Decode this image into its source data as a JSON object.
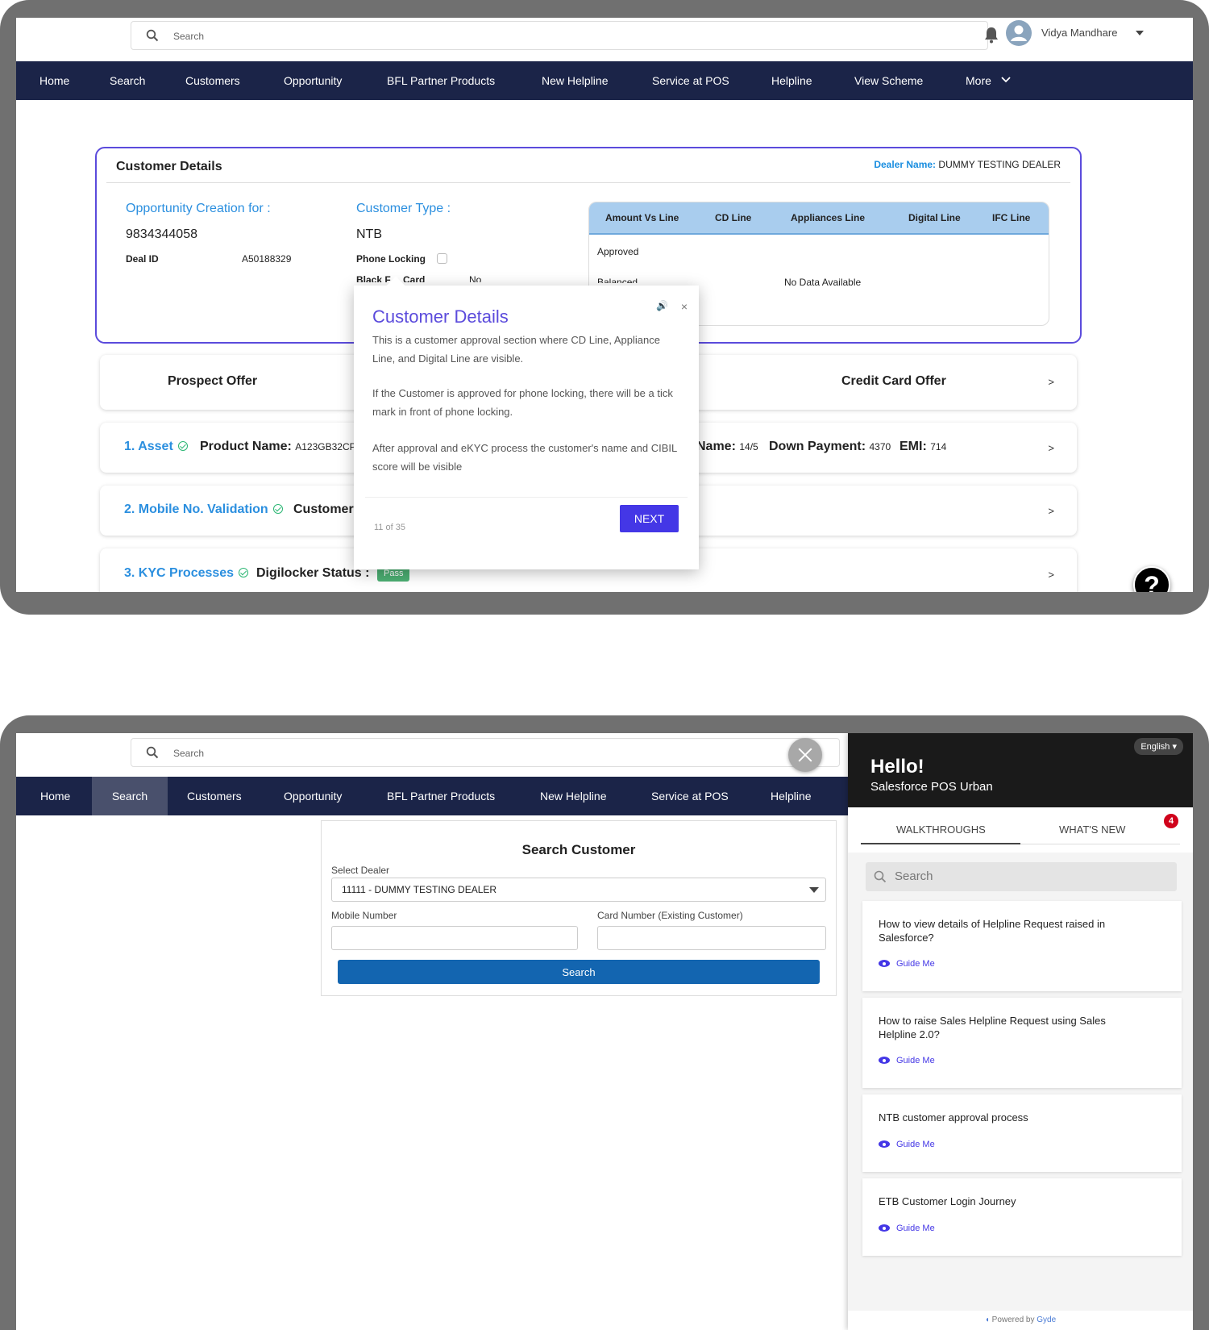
{
  "screen1": {
    "search_placeholder": "Search",
    "user_name": "Vidya Mandhare",
    "nav": [
      "Home",
      "Search",
      "Customers",
      "Opportunity",
      "BFL Partner Products",
      "New Helpline",
      "Service at POS",
      "Helpline",
      "View Scheme",
      "More"
    ],
    "customer_details": {
      "title": "Customer Details",
      "dealer_label": "Dealer Name:",
      "dealer_value": "DUMMY TESTING DEALER",
      "opp_label": "Opportunity Creation for :",
      "opp_value": "9834344058",
      "deal_id_label": "Deal ID",
      "deal_id_value": "A50188329",
      "cust_type_label": "Customer Type :",
      "cust_type_value": "NTB",
      "phone_locking_label": "Phone Locking",
      "black_card_label": "Black F",
      "black_card_label2": "Card",
      "black_card_value": "No",
      "table_headers": [
        "Amount Vs Line",
        "CD Line",
        "Appliances Line",
        "Digital Line",
        "IFC Line"
      ],
      "row_approved": "Approved",
      "row_balanced": "Balanced",
      "no_data": "No Data Available"
    },
    "prospect_offer": "Prospect Offer",
    "credit_card_offer": "Credit Card Offer",
    "asset": {
      "label": "1. Asset",
      "product_label": "Product Name:",
      "product_value": "A123GB32CP",
      "scheme_label": "Name:",
      "scheme_value": "14/5",
      "down_label": "Down Payment:",
      "down_value": "4370",
      "emi_label": "EMI:",
      "emi_value": "714"
    },
    "mobile": {
      "label": "2. Mobile No. Validation",
      "customer_label": "Customer"
    },
    "kyc": {
      "label": "3. KYC Processes",
      "digilocker_label": "Digilocker Status :",
      "digilocker_value": "Pass"
    },
    "chevron": ">",
    "popup": {
      "title": "Customer Details",
      "p1": "This is a customer approval section where CD Line, Appliance Line, and Digital Line are visible.",
      "p2": "If the Customer is approved for phone locking, there will be a tick mark in front of phone locking.",
      "p3": "After approval and eKYC process the customer's name and CIBIL score will be visible",
      "step": "11 of 35",
      "next": "NEXT",
      "close": "×",
      "speaker": "🔊"
    },
    "help": "?"
  },
  "screen2": {
    "search_placeholder": "Search",
    "nav": [
      "Home",
      "Search",
      "Customers",
      "Opportunity",
      "BFL Partner Products",
      "New Helpline",
      "Service at POS",
      "Helpline"
    ],
    "search_customer": {
      "title": "Search Customer",
      "select_dealer_label": "Select Dealer",
      "select_dealer_value": "11111 - DUMMY TESTING DEALER",
      "mobile_label": "Mobile Number",
      "card_label": "Card Number (Existing Customer)",
      "button": "Search"
    },
    "panel": {
      "lang": "English ▾",
      "hello": "Hello!",
      "sub": "Salesforce POS Urban",
      "tab1": "WALKTHROUGHS",
      "tab2": "WHAT'S NEW",
      "badge": "4",
      "search_placeholder": "Search",
      "items": [
        {
          "title": "How to view details of Helpline Request raised in Salesforce?",
          "action": "Guide Me"
        },
        {
          "title": "How to raise Sales Helpline Request using Sales Helpline 2.0?",
          "action": "Guide Me"
        },
        {
          "title": "NTB customer approval process",
          "action": "Guide Me"
        },
        {
          "title": "ETB Customer Login Journey",
          "action": "Guide Me"
        }
      ],
      "powered_label": "Powered by",
      "powered_brand": "Gyde"
    }
  }
}
